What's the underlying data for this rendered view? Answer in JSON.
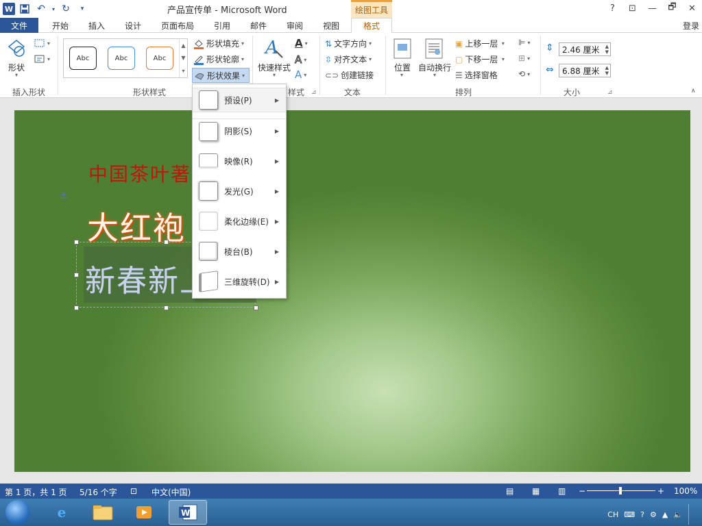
{
  "window": {
    "title": "产品宣传单 - Microsoft Word",
    "context_tab_group": "绘图工具",
    "controls": {
      "help": "?",
      "ribbon_opts": "⊡",
      "restore": "🗗",
      "close": "✕"
    }
  },
  "tabs": [
    {
      "label": "文件"
    },
    {
      "label": "开始"
    },
    {
      "label": "插入"
    },
    {
      "label": "设计"
    },
    {
      "label": "页面布局"
    },
    {
      "label": "引用"
    },
    {
      "label": "邮件"
    },
    {
      "label": "审阅"
    },
    {
      "label": "视图"
    },
    {
      "label": "格式"
    }
  ],
  "login": "登录",
  "ribbon": {
    "insert_shape": {
      "shape_btn": "形状",
      "group": "插入形状"
    },
    "shape_styles": {
      "gallery": [
        "Abc",
        "Abc",
        "Abc"
      ],
      "fill": "形状填充",
      "outline": "形状轮廓",
      "effects": "形状效果",
      "group": "形状样式"
    },
    "art_styles": {
      "quick_styles": "快速样式",
      "group_suffix": "样式"
    },
    "text": {
      "direction": "文字方向",
      "align": "对齐文本",
      "link": "创建链接",
      "group": "文本"
    },
    "arrange": {
      "position": "位置",
      "wrap": "自动换行",
      "bring_forward": "上移一层",
      "send_backward": "下移一层",
      "selection_pane": "选择窗格",
      "group": "排列"
    },
    "size": {
      "height": "2.46 厘米",
      "width": "6.88 厘米",
      "group": "大小"
    }
  },
  "effects_menu": [
    {
      "label": "预设(P)"
    },
    {
      "label": "阴影(S)"
    },
    {
      "label": "映像(R)"
    },
    {
      "label": "发光(G)"
    },
    {
      "label": "柔化边缘(E)"
    },
    {
      "label": "棱台(B)"
    },
    {
      "label": "三维旋转(D)"
    }
  ],
  "document": {
    "slogan": "中国茶叶著",
    "product": "大红袍",
    "textbox_text": "新春新上"
  },
  "status": {
    "page": "第 1 页，共 1 页",
    "words": "5/16 个字",
    "language": "中文(中国)",
    "zoom": "100%",
    "zoom_minus": "−",
    "zoom_plus": "+"
  },
  "tray": {
    "ime": "CH"
  },
  "colors": {
    "accent": "#2b579a",
    "context": "#b85c00",
    "page_green": "#5b8a3c"
  }
}
